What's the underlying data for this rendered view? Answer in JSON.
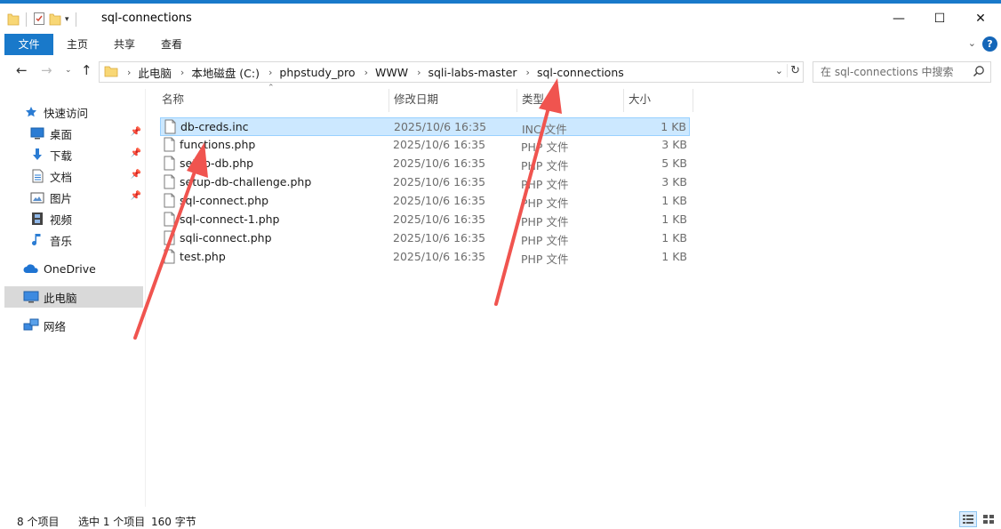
{
  "window": {
    "title": "sql-connections",
    "minimize_glyph": "—",
    "maximize_glyph": "☐",
    "close_glyph": "✕"
  },
  "ribbon": {
    "tabs": [
      "文件",
      "主页",
      "共享",
      "查看"
    ],
    "expand_glyph": "⌄",
    "help_glyph": "?"
  },
  "address": {
    "breadcrumbs": [
      "此电脑",
      "本地磁盘 (C:)",
      "phpstudy_pro",
      "WWW",
      "sqli-labs-master",
      "sql-connections"
    ]
  },
  "search": {
    "placeholder": "在 sql-connections 中搜索"
  },
  "nav": {
    "items": [
      {
        "label": "快速访问",
        "icon": "star-icon"
      },
      {
        "label": "桌面",
        "icon": "desktop-icon",
        "pinned": true
      },
      {
        "label": "下载",
        "icon": "download-icon",
        "pinned": true
      },
      {
        "label": "文档",
        "icon": "document-icon",
        "pinned": true
      },
      {
        "label": "图片",
        "icon": "picture-icon",
        "pinned": true
      },
      {
        "label": "视频",
        "icon": "video-icon"
      },
      {
        "label": "音乐",
        "icon": "music-icon"
      },
      {
        "label": "OneDrive",
        "icon": "cloud-icon"
      },
      {
        "label": "此电脑",
        "icon": "computer-icon",
        "selected": true
      },
      {
        "label": "网络",
        "icon": "network-icon"
      }
    ]
  },
  "columns": [
    "名称",
    "修改日期",
    "类型",
    "大小"
  ],
  "files": [
    {
      "name": "db-creds.inc",
      "date": "2025/10/6 16:35",
      "type": "INC 文件",
      "size": "1 KB",
      "selected": true
    },
    {
      "name": "functions.php",
      "date": "2025/10/6 16:35",
      "type": "PHP 文件",
      "size": "3 KB"
    },
    {
      "name": "setup-db.php",
      "date": "2025/10/6 16:35",
      "type": "PHP 文件",
      "size": "5 KB"
    },
    {
      "name": "setup-db-challenge.php",
      "date": "2025/10/6 16:35",
      "type": "PHP 文件",
      "size": "3 KB"
    },
    {
      "name": "sql-connect.php",
      "date": "2025/10/6 16:35",
      "type": "PHP 文件",
      "size": "1 KB"
    },
    {
      "name": "sql-connect-1.php",
      "date": "2025/10/6 16:35",
      "type": "PHP 文件",
      "size": "1 KB"
    },
    {
      "name": "sqli-connect.php",
      "date": "2025/10/6 16:35",
      "type": "PHP 文件",
      "size": "1 KB"
    },
    {
      "name": "test.php",
      "date": "2025/10/6 16:35",
      "type": "PHP 文件",
      "size": "1 KB"
    }
  ],
  "status": {
    "item_count": "8 个项目",
    "selected": "选中 1 个项目",
    "size": "160 字节"
  },
  "colors": {
    "accent": "#1979ca",
    "selection_bg": "#cce8ff",
    "selection_border": "#99d1ff",
    "folder": "#f8d775",
    "annotation_arrow": "#f0544f"
  }
}
